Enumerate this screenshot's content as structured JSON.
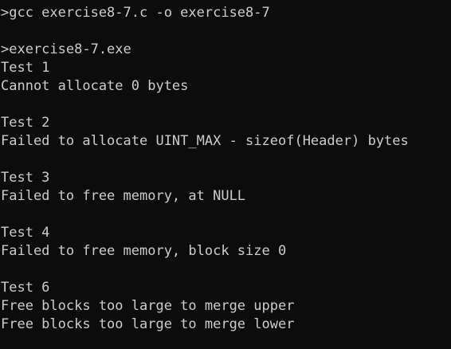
{
  "console": {
    "lines": [
      ">gcc exercise8-7.c -o exercise8-7",
      "",
      ">exercise8-7.exe",
      "Test 1",
      "Cannot allocate 0 bytes",
      "",
      "Test 2",
      "Failed to allocate UINT_MAX - sizeof(Header) bytes",
      "",
      "Test 3",
      "Failed to free memory, at NULL",
      "",
      "Test 4",
      "Failed to free memory, block size 0",
      "",
      "Test 6",
      "Free blocks too large to merge upper",
      "Free blocks too large to merge lower"
    ]
  },
  "colors": {
    "background": "#0c0c0c",
    "text": "#cccccc"
  }
}
